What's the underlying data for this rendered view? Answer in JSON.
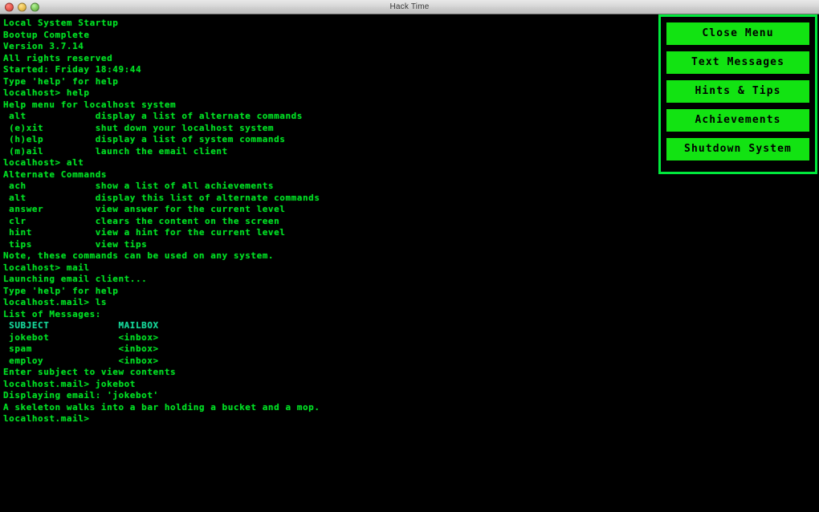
{
  "window": {
    "title": "Hack Time",
    "traffic_lights": [
      "close",
      "minimize",
      "maximize"
    ]
  },
  "terminal": {
    "prompt_system": "localhost>",
    "prompt_mail": "localhost.mail>",
    "lines": [
      {
        "text": "Local System Startup",
        "style": "normal"
      },
      {
        "text": "Bootup Complete",
        "style": "normal"
      },
      {
        "text": "Version 3.7.14",
        "style": "normal"
      },
      {
        "text": "All rights reserved",
        "style": "normal"
      },
      {
        "text": "Started: Friday 18:49:44",
        "style": "normal"
      },
      {
        "text": "Type 'help' for help",
        "style": "normal"
      },
      {
        "text": "localhost> help",
        "style": "normal"
      },
      {
        "text": "Help menu for localhost system",
        "style": "normal"
      },
      {
        "text": " alt            display a list of alternate commands",
        "style": "normal"
      },
      {
        "text": " (e)xit         shut down your localhost system",
        "style": "normal"
      },
      {
        "text": " (h)elp         display a list of system commands",
        "style": "normal"
      },
      {
        "text": " (m)ail         launch the email client",
        "style": "normal"
      },
      {
        "text": "localhost> alt",
        "style": "normal"
      },
      {
        "text": "Alternate Commands",
        "style": "normal"
      },
      {
        "text": " ach            show a list of all achievements",
        "style": "normal"
      },
      {
        "text": " alt            display this list of alternate commands",
        "style": "normal"
      },
      {
        "text": " answer         view answer for the current level",
        "style": "normal"
      },
      {
        "text": " clr            clears the content on the screen",
        "style": "normal"
      },
      {
        "text": " hint           view a hint for the current level",
        "style": "normal"
      },
      {
        "text": " tips           view tips",
        "style": "normal"
      },
      {
        "text": "Note, these commands can be used on any system.",
        "style": "normal"
      },
      {
        "text": "localhost> mail",
        "style": "normal"
      },
      {
        "text": "Launching email client...",
        "style": "normal"
      },
      {
        "text": "Type 'help' for help",
        "style": "normal"
      },
      {
        "text": "localhost.mail> ls",
        "style": "normal"
      },
      {
        "text": "List of Messages:",
        "style": "normal"
      },
      {
        "text": " SUBJECT            MAILBOX",
        "style": "header"
      },
      {
        "text": " jokebot            <inbox>",
        "style": "normal"
      },
      {
        "text": " spam               <inbox>",
        "style": "normal"
      },
      {
        "text": " employ             <inbox>",
        "style": "normal"
      },
      {
        "text": "Enter subject to view contents",
        "style": "normal"
      },
      {
        "text": "localhost.mail> jokebot",
        "style": "normal"
      },
      {
        "text": "Displaying email: 'jokebot'",
        "style": "normal"
      },
      {
        "text": "A skeleton walks into a bar holding a bucket and a mop.",
        "style": "normal"
      },
      {
        "text": "localhost.mail>",
        "style": "normal"
      }
    ],
    "colors": {
      "background": "#000000",
      "text": "#00e024",
      "header_text": "#16d79a"
    }
  },
  "menu": {
    "buttons": [
      {
        "label": "Close Menu",
        "name": "close-menu-button"
      },
      {
        "label": "Text Messages",
        "name": "text-messages-button"
      },
      {
        "label": "Hints & Tips",
        "name": "hints-and-tips-button"
      },
      {
        "label": "Achievements",
        "name": "achievements-button"
      },
      {
        "label": "Shutdown System",
        "name": "shutdown-system-button"
      }
    ],
    "colors": {
      "border": "#00e83c",
      "button_fill": "#12e312",
      "button_text": "#000000"
    }
  }
}
